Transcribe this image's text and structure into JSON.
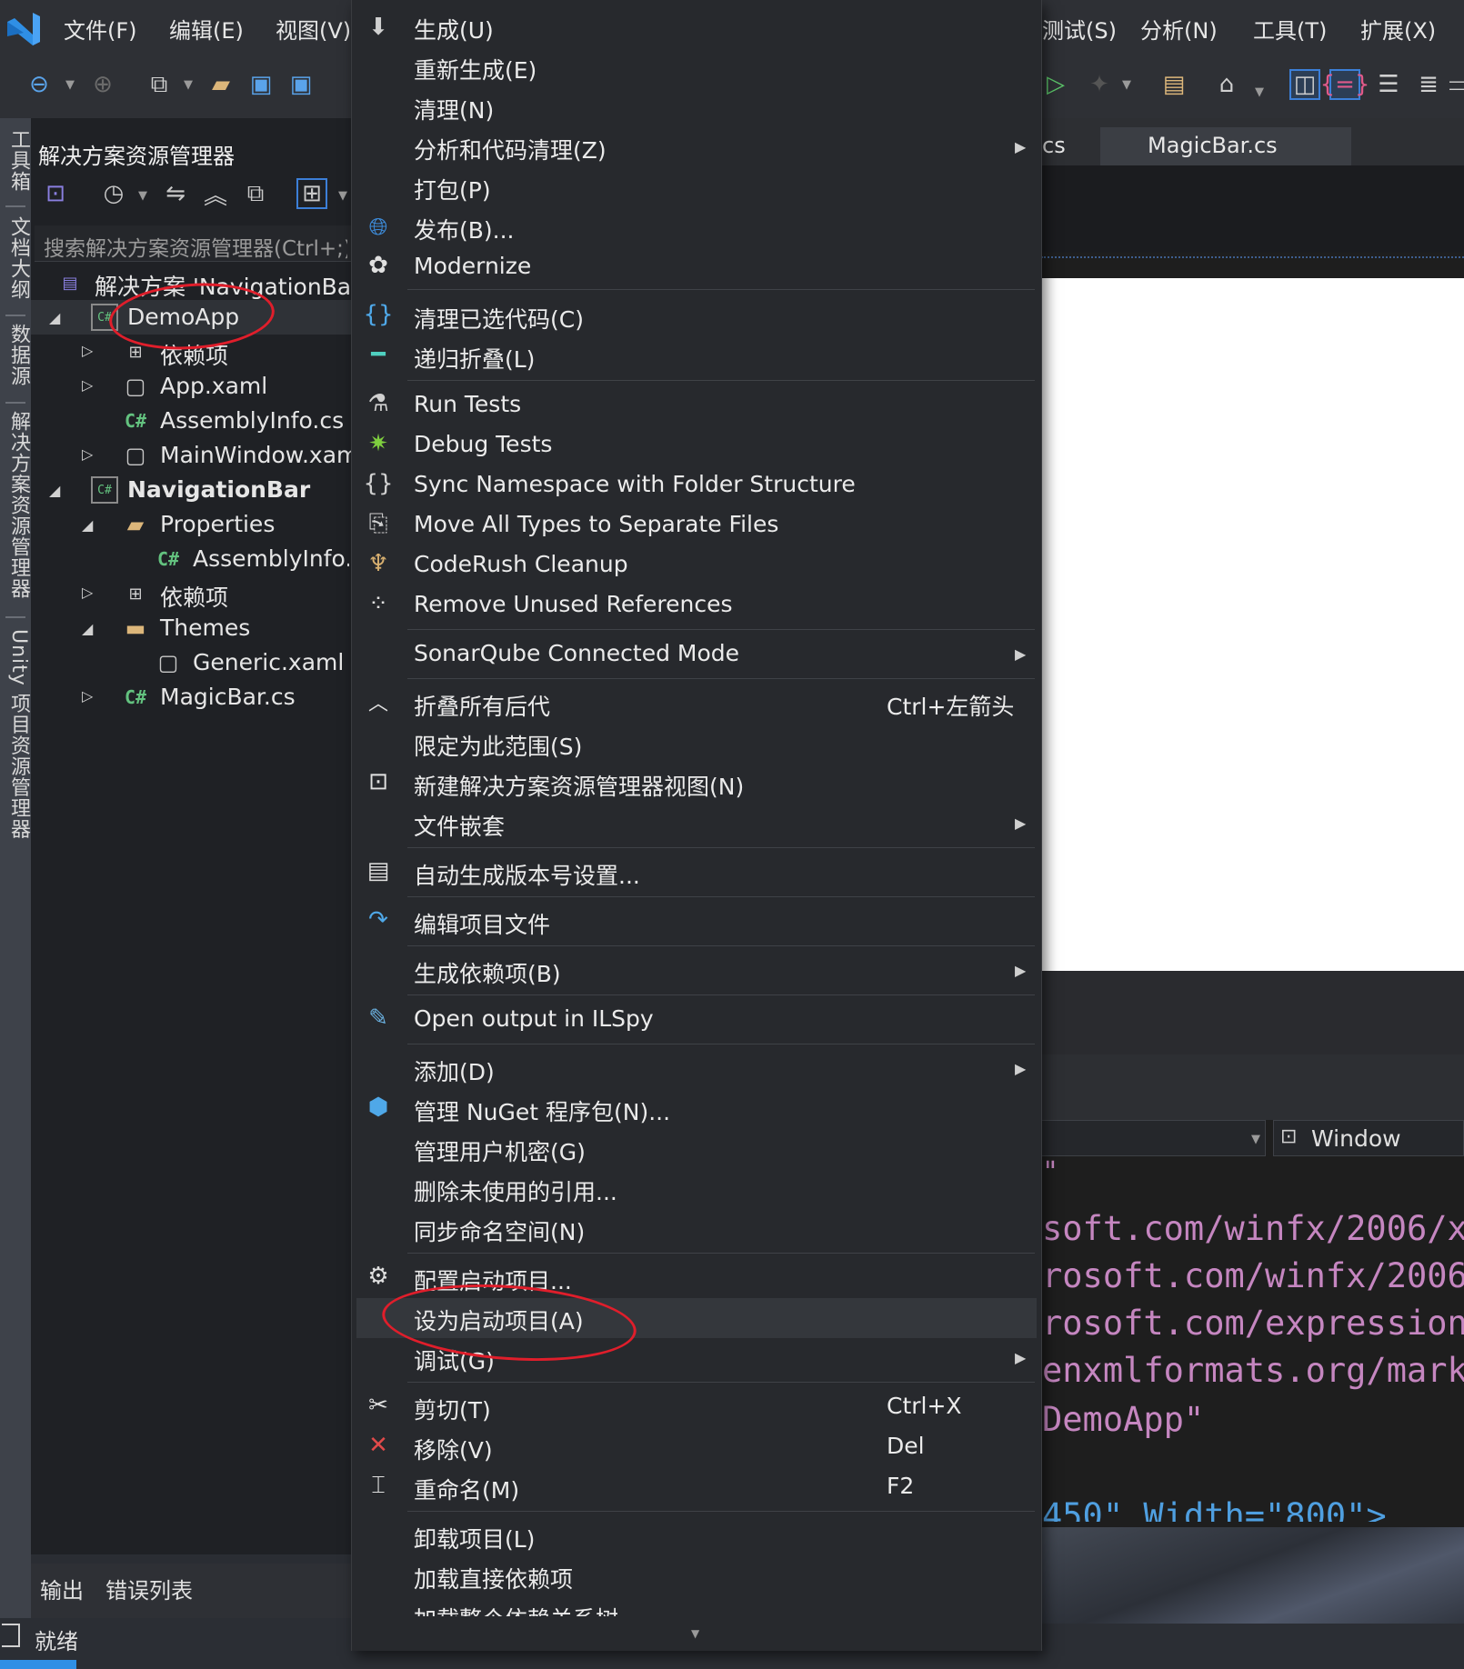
{
  "menubar": {
    "items": [
      "文件(F)",
      "编辑(E)",
      "视图(V)",
      "测试(S)",
      "分析(N)",
      "工具(T)",
      "扩展(X)"
    ]
  },
  "left_strip": {
    "tabs": [
      "工具箱",
      "文档大纲",
      "数据源",
      "解决方案资源管理器",
      "Unity 项目资源管理器"
    ]
  },
  "solution_explorer": {
    "title": "解决方案资源管理器",
    "search_placeholder": "搜索解决方案资源管理器(Ctrl+;)",
    "tree": [
      {
        "label": "解决方案 'NavigationBar'",
        "icon": "solution-icon"
      },
      {
        "label": "DemoApp",
        "icon": "csharp-project-icon"
      },
      {
        "label": "依赖项",
        "icon": "dependencies-icon"
      },
      {
        "label": "App.xaml",
        "icon": "xaml-file-icon"
      },
      {
        "label": "AssemblyInfo.cs",
        "icon": "csharp-file-icon"
      },
      {
        "label": "MainWindow.xaml",
        "icon": "xaml-file-icon"
      },
      {
        "label": "NavigationBar",
        "icon": "csharp-project-icon"
      },
      {
        "label": "Properties",
        "icon": "properties-folder-icon"
      },
      {
        "label": "AssemblyInfo.cs",
        "icon": "csharp-file-icon"
      },
      {
        "label": "依赖项",
        "icon": "dependencies-icon"
      },
      {
        "label": "Themes",
        "icon": "folder-icon"
      },
      {
        "label": "Generic.xaml",
        "icon": "xaml-file-icon"
      },
      {
        "label": "MagicBar.cs",
        "icon": "csharp-file-icon"
      }
    ]
  },
  "bottom_tabs": [
    "输出",
    "错误列表"
  ],
  "status": {
    "text": "就绪"
  },
  "editor": {
    "tab_partial": "cs",
    "tab_active": "MagicBar.cs",
    "view_selector": "Window",
    "code_lines": [
      "\"",
      "soft.com/winfx/2006/x",
      "rosoft.com/winfx/2006",
      "rosoft.com/expression",
      "enxmlformats.org/mark",
      "DemoApp\"",
      "",
      "450\" Width=\"800\">"
    ]
  },
  "context_menu": {
    "items": [
      {
        "label": "生成(U)",
        "icon": "build-icon"
      },
      {
        "label": "重新生成(E)"
      },
      {
        "label": "清理(N)"
      },
      {
        "label": "分析和代码清理(Z)",
        "submenu": true
      },
      {
        "label": "打包(P)"
      },
      {
        "label": "发布(B)...",
        "icon": "publish-globe-icon"
      },
      {
        "label": "Modernize",
        "icon": "modernize-icon"
      },
      {
        "label": "清理已选代码(C)",
        "icon": "curly-braces-icon"
      },
      {
        "label": "递归折叠(L)",
        "icon": "collapse-line-icon"
      },
      {
        "label": "Run Tests",
        "icon": "run-tests-icon"
      },
      {
        "label": "Debug Tests",
        "icon": "bug-icon"
      },
      {
        "label": "Sync Namespace with Folder Structure",
        "icon": "sync-namespace-icon"
      },
      {
        "label": "Move All Types to Separate Files",
        "icon": "move-types-icon"
      },
      {
        "label": "CodeRush Cleanup",
        "icon": "broom-icon"
      },
      {
        "label": "Remove Unused References",
        "icon": "remove-references-icon"
      },
      {
        "label": "SonarQube Connected Mode",
        "submenu": true
      },
      {
        "label": "折叠所有后代",
        "shortcut": "Ctrl+左箭头",
        "icon": "chevron-up-icon"
      },
      {
        "label": "限定为此范围(S)"
      },
      {
        "label": "新建解决方案资源管理器视图(N)",
        "icon": "new-view-icon"
      },
      {
        "label": "文件嵌套",
        "submenu": true
      },
      {
        "label": "自动生成版本号设置...",
        "icon": "version-settings-icon"
      },
      {
        "label": "编辑项目文件",
        "icon": "edit-arrow-icon"
      },
      {
        "label": "生成依赖项(B)",
        "submenu": true
      },
      {
        "label": "Open output in ILSpy",
        "icon": "ilspy-icon"
      },
      {
        "label": "添加(D)",
        "submenu": true
      },
      {
        "label": "管理 NuGet 程序包(N)...",
        "icon": "nuget-icon"
      },
      {
        "label": "管理用户机密(G)"
      },
      {
        "label": "删除未使用的引用..."
      },
      {
        "label": "同步命名空间(N)"
      },
      {
        "label": "配置启动项目...",
        "icon": "gear-icon"
      },
      {
        "label": "设为启动项目(A)"
      },
      {
        "label": "调试(G)",
        "submenu": true
      },
      {
        "label": "剪切(T)",
        "shortcut": "Ctrl+X",
        "icon": "scissors-icon"
      },
      {
        "label": "移除(V)",
        "shortcut": "Del",
        "icon": "close-icon"
      },
      {
        "label": "重命名(M)",
        "shortcut": "F2",
        "icon": "rename-icon"
      },
      {
        "label": "卸载项目(L)"
      },
      {
        "label": "加载直接依赖项"
      },
      {
        "label": "加载整个依赖关系树"
      }
    ]
  },
  "colors": {
    "accent_blue": "#2f8fe5",
    "annotation_red": "#e01e2b",
    "csharp_green": "#63c27f",
    "code_purple": "#c586c0"
  }
}
